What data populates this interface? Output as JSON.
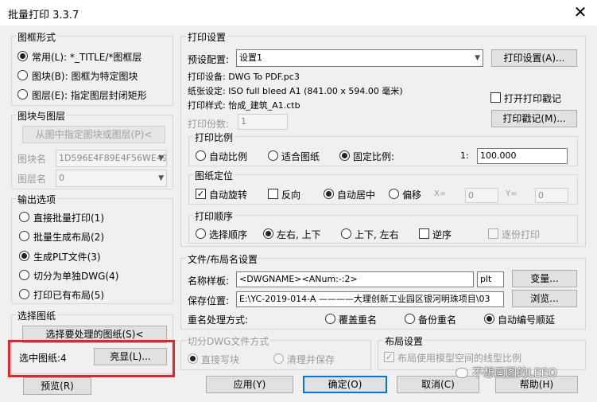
{
  "window": {
    "title": "批量打印 3.3.7",
    "close_glyph": "✕"
  },
  "frame_shape": {
    "label": "图框形式",
    "options": [
      {
        "label": "常用(L): *_TITLE/*图框层",
        "selected": true
      },
      {
        "label": "图块(B): 图框为特定图块",
        "selected": false
      },
      {
        "label": "图层(E): 指定图层封闭矩形",
        "selected": false
      }
    ]
  },
  "block_layer": {
    "label": "图块与图层",
    "pick_button": "从图中指定图块或图层(P)<",
    "block_name_label": "图块名",
    "block_name_value": "1D596E4F89E4F56WE49",
    "layer_name_label": "图层名",
    "layer_name_value": "0"
  },
  "output": {
    "label": "输出选项",
    "options": [
      {
        "label": "直接批量打印(1)",
        "selected": false
      },
      {
        "label": "批量生成布局(2)",
        "selected": false
      },
      {
        "label": "生成PLT文件(3)",
        "selected": true
      },
      {
        "label": "切分为单独DWG(4)",
        "selected": false
      },
      {
        "label": "打印已有布局(5)",
        "selected": false
      }
    ]
  },
  "select_drawings": {
    "label": "选择图纸",
    "select_button": "选择要处理的图纸(S)<",
    "selected_count_label": "选中图纸:4",
    "highlight_button": "亮显(L)..."
  },
  "print_settings": {
    "label": "打印设置",
    "preset_label": "预设配置:",
    "preset_value": "设置1",
    "print_setup_button": "打印设置(A)...",
    "device": "打印设备: DWG To PDF.pc3",
    "paper": "纸张设定: ISO full bleed A1 (841.00 x 594.00 毫米)",
    "style": "打印样式: 怡成_建筑_A1.ctb",
    "open_stamp_label": "打开打印戳记",
    "open_stamp_checked": false,
    "copies_label": "打印份数:",
    "copies_value": "1",
    "stamp_button": "打印戳记(M)..."
  },
  "scale": {
    "label": "打印比例",
    "options": [
      {
        "label": "自动比例",
        "selected": false
      },
      {
        "label": "适合图纸",
        "selected": false
      },
      {
        "label": "固定比例:",
        "selected": true
      }
    ],
    "ratio_prefix": "1:",
    "ratio_value": "100.000"
  },
  "placement": {
    "label": "图纸定位",
    "auto_rotate_label": "自动旋转",
    "auto_rotate_checked": true,
    "reverse_label": "反向",
    "reverse_checked": false,
    "center_label": "自动居中",
    "center_selected": true,
    "offset_label": "偏移",
    "offset_selected": false,
    "x_label": "X=",
    "x_value": "0",
    "y_label": "Y=",
    "y_value": "0"
  },
  "order": {
    "label": "打印顺序",
    "options": [
      {
        "label": "选择顺序",
        "selected": false
      },
      {
        "label": "左右, 上下",
        "selected": true
      },
      {
        "label": "上下, 左右",
        "selected": false
      }
    ],
    "reverse_label": "逆序",
    "reverse_checked": false,
    "per_copy_label": "逐份打印",
    "per_copy_checked": false
  },
  "file_naming": {
    "label": "文件/布局名设置",
    "template_label": "名称样板:",
    "template_value": "<DWGNAME><ANum:-:2>",
    "ext_value": "plt",
    "variable_button": "变量...",
    "save_label": "保存位置:",
    "save_value": "E:\\YC-2019-014-A ————大理创新工业园区银河明珠项目\\03",
    "browse_button": "浏览...",
    "duplicate_label": "重名处理方式:",
    "duplicate_options": [
      {
        "label": "覆盖重名",
        "selected": false
      },
      {
        "label": "备份重名",
        "selected": false
      },
      {
        "label": "自动编号顺延",
        "selected": true
      }
    ]
  },
  "split_dwg": {
    "label": "切分DWG文件方式",
    "options": [
      {
        "label": "直接写块",
        "selected": true
      },
      {
        "label": "清理并保存",
        "selected": false
      }
    ]
  },
  "layout_settings": {
    "label": "布局设置",
    "linetype_label": "布局使用模型空间的线型比例",
    "linetype_checked": true
  },
  "footer": {
    "preview_button": "预览(R)",
    "apply_button": "应用(Y)",
    "ok_button": "确定(O)",
    "cancel_button": "取消(C)",
    "help_button": "帮助(H)"
  },
  "watermark": {
    "text": "不想画图的LEEO"
  },
  "colors": {
    "highlight_box": "#e8242a",
    "default_button_border": "#0078d7"
  }
}
